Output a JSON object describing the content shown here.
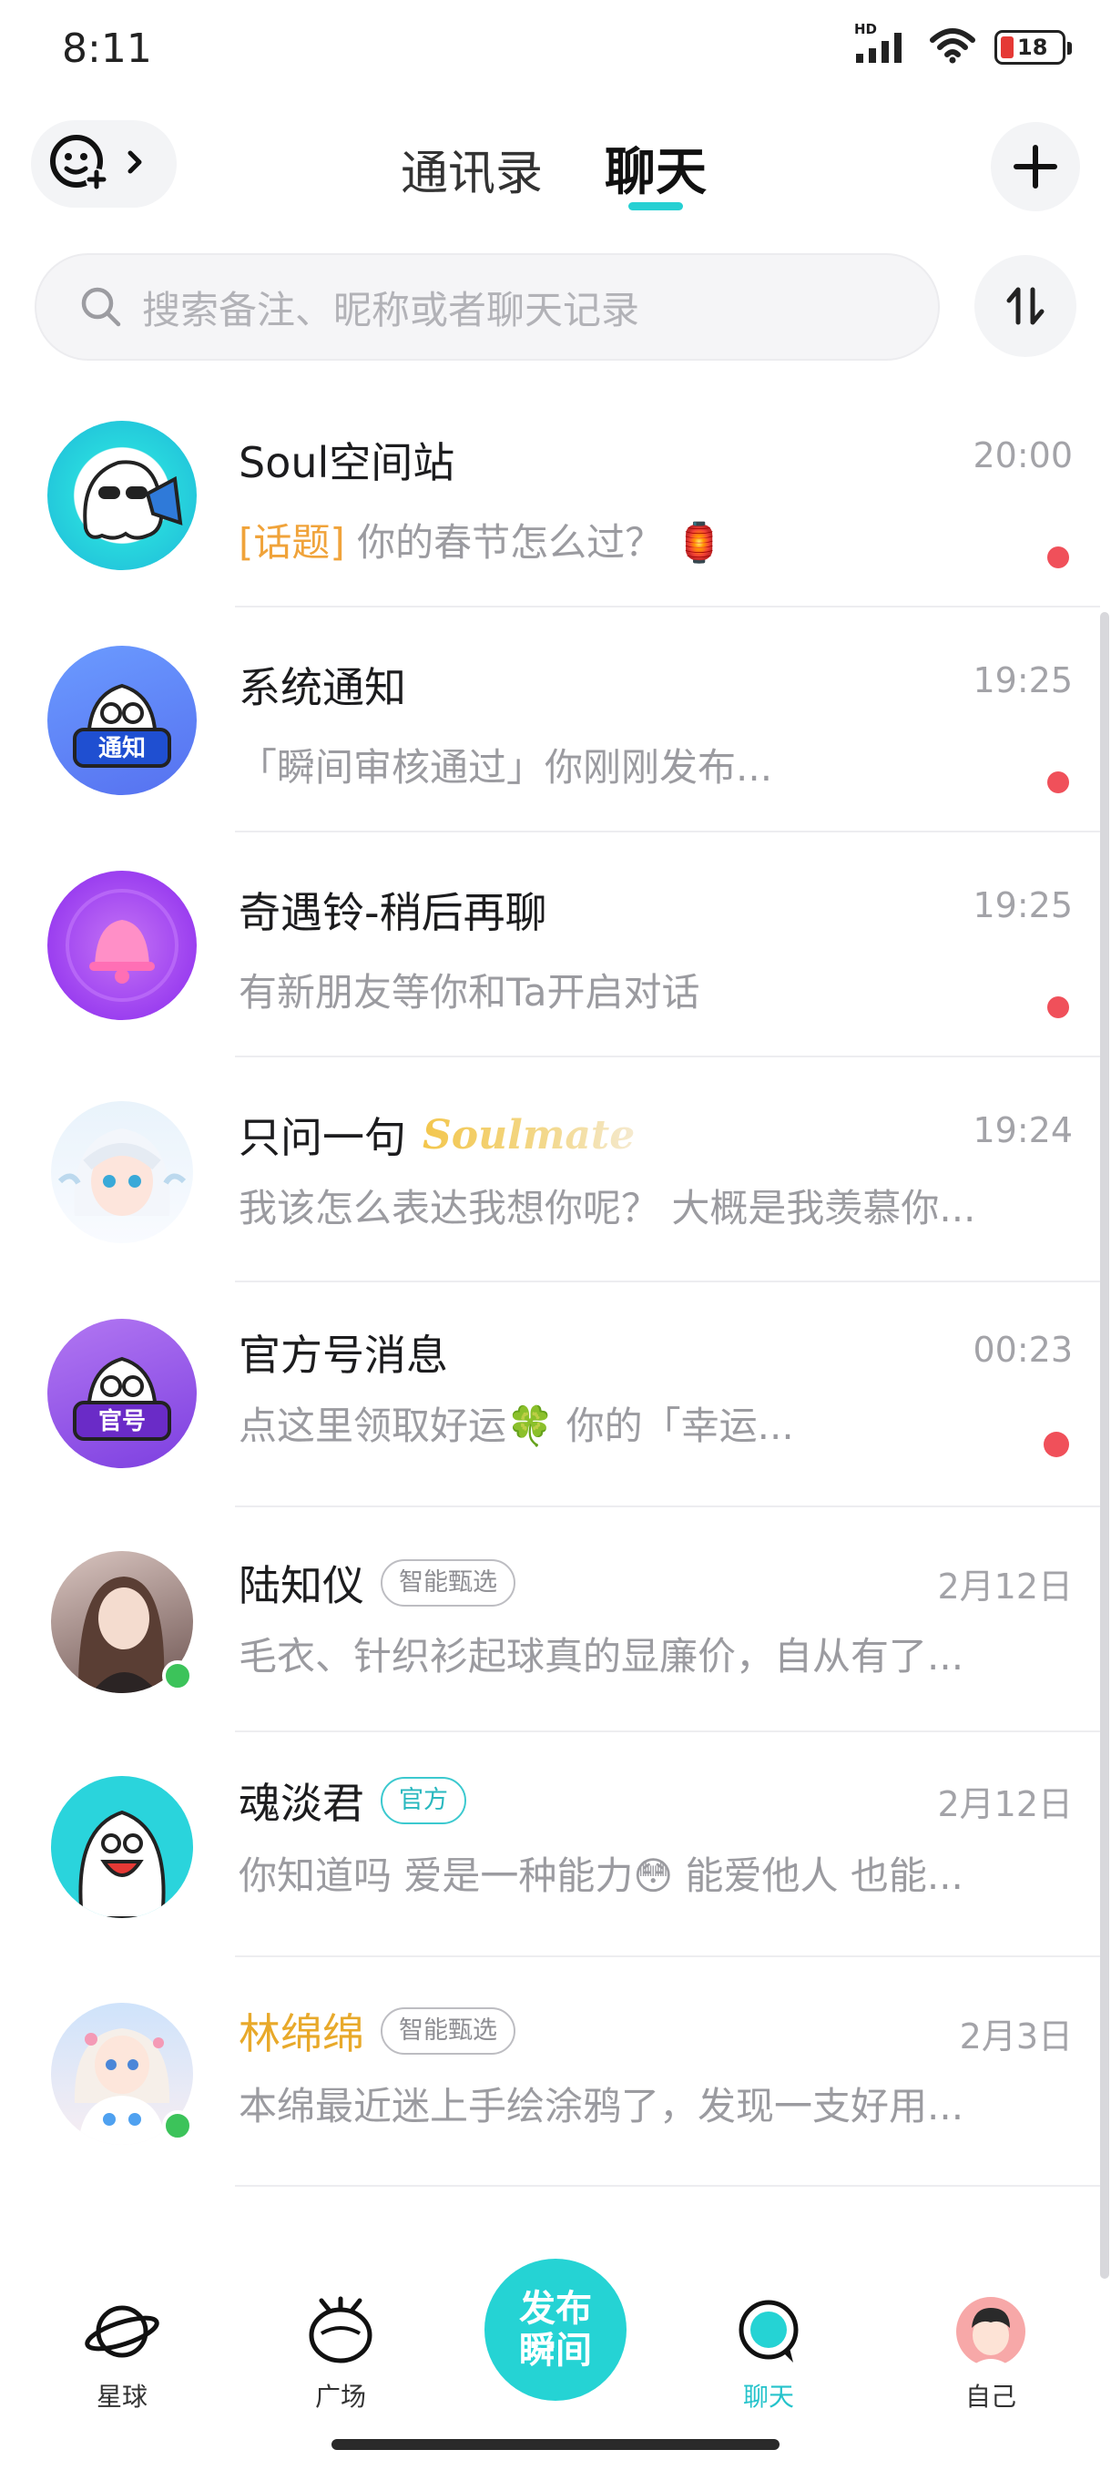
{
  "status": {
    "time": "8:11",
    "hd": "HD",
    "battery": "18"
  },
  "header": {
    "tab_contacts": "通讯录",
    "tab_chat": "聊天"
  },
  "search": {
    "placeholder": "搜索备注、昵称或者聊天记录"
  },
  "chats": [
    {
      "name": "Soul空间站",
      "time": "20:00",
      "topic": "[话题]",
      "preview": " 你的春节怎么过？ 🏮",
      "unread": true
    },
    {
      "name": "系统通知",
      "time": "19:25",
      "preview": "「瞬间审核通过」你刚刚发布...",
      "unread": true
    },
    {
      "name": "奇遇铃-稍后再聊",
      "time": "19:25",
      "preview": "有新朋友等你和Ta开启对话",
      "unread": true
    },
    {
      "name": "只问一句",
      "badge": "Soulmate",
      "time": "19:24",
      "preview": "我该怎么表达我想你呢？ 大概是我羡慕你...",
      "unread": false
    },
    {
      "name": "官方号消息",
      "time": "00:23",
      "preview": "点这里领取好运🍀 你的「幸运...",
      "unread": true
    },
    {
      "name": "陆知仪",
      "tag": "智能甄选",
      "time": "2月12日",
      "preview": "毛衣、针织衫起球真的显廉价，自从有了...",
      "online": true
    },
    {
      "name": "魂淡君",
      "tag": "官方",
      "time": "2月12日",
      "preview": "你知道吗 爱是一种能力😳 能爱他人 也能...",
      "online": false
    },
    {
      "name": "林绵绵",
      "tag": "智能甄选",
      "time": "2月3日",
      "preview": "本绵最近迷上手绘涂鸦了，发现一支好用...",
      "online": true,
      "name_color": "#e8a92a"
    }
  ],
  "nav": {
    "planet": "星球",
    "square": "广场",
    "publish_line1": "发布",
    "publish_line2": "瞬间",
    "chat": "聊天",
    "me": "自己"
  },
  "colors": {
    "accent": "#25d3d4",
    "unread": "#f0505a",
    "online": "#3cc35a",
    "topic": "#f0a33a"
  }
}
